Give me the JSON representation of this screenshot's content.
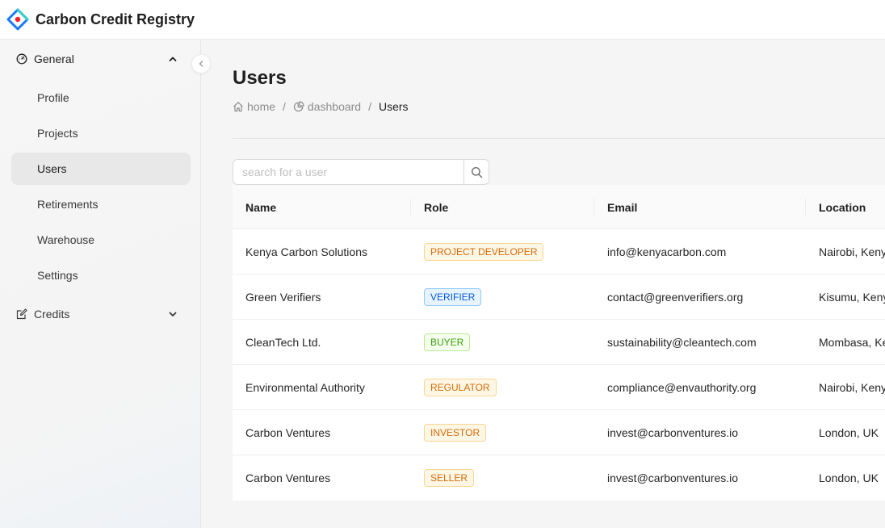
{
  "app": {
    "title": "Carbon Credit Registry"
  },
  "sidebar": {
    "groups": [
      {
        "label": "General",
        "expanded": true,
        "items": [
          {
            "label": "Profile"
          },
          {
            "label": "Projects"
          },
          {
            "label": "Users",
            "active": true
          },
          {
            "label": "Retirements"
          },
          {
            "label": "Warehouse"
          },
          {
            "label": "Settings"
          }
        ]
      },
      {
        "label": "Credits",
        "expanded": false,
        "items": []
      }
    ]
  },
  "page": {
    "title": "Users",
    "breadcrumb": [
      {
        "label": "home",
        "icon": "home-icon"
      },
      {
        "label": "dashboard",
        "icon": "pie-chart-icon"
      },
      {
        "label": "Users"
      }
    ],
    "breadcrumb_separator": "/"
  },
  "search": {
    "placeholder": "search for a user",
    "value": ""
  },
  "table": {
    "columns": [
      "Name",
      "Role",
      "Email",
      "Location"
    ],
    "rows": [
      {
        "name": "Kenya Carbon Solutions",
        "role": "PROJECT DEVELOPER",
        "role_color": "orange",
        "email": "info@kenyacarbon.com",
        "location": "Nairobi, Kenya"
      },
      {
        "name": "Green Verifiers",
        "role": "VERIFIER",
        "role_color": "blue",
        "email": "contact@greenverifiers.org",
        "location": "Kisumu, Kenya"
      },
      {
        "name": "CleanTech Ltd.",
        "role": "BUYER",
        "role_color": "green",
        "email": "sustainability@cleantech.com",
        "location": "Mombasa, Kenya"
      },
      {
        "name": "Environmental Authority",
        "role": "REGULATOR",
        "role_color": "orange",
        "email": "compliance@envauthority.org",
        "location": "Nairobi, Kenya"
      },
      {
        "name": "Carbon Ventures",
        "role": "INVESTOR",
        "role_color": "orange",
        "email": "invest@carbonventures.io",
        "location": "London, UK"
      },
      {
        "name": "Carbon Ventures",
        "role": "SELLER",
        "role_color": "orange",
        "email": "invest@carbonventures.io",
        "location": "London, UK"
      }
    ]
  },
  "colors": {
    "accent_blue": "#1677ff",
    "accent_red": "#f5222d",
    "tag_orange": {
      "text": "#d46b08",
      "bg": "#fff7e6",
      "border": "#ffd591"
    },
    "tag_blue": {
      "text": "#0958d9",
      "bg": "#e6f4ff",
      "border": "#91caff"
    },
    "tag_green": {
      "text": "#389e0d",
      "bg": "#f6ffed",
      "border": "#b7eb8f"
    }
  }
}
